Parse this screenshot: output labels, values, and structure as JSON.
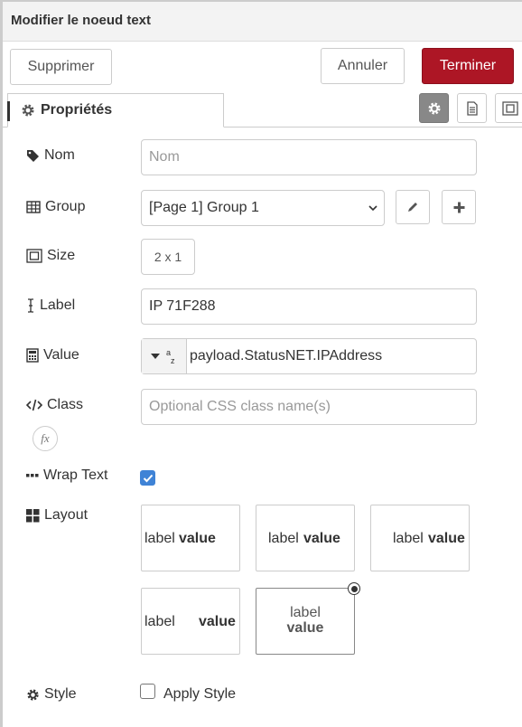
{
  "dialog": {
    "title": "Modifier le noeud text"
  },
  "toolbar": {
    "delete_label": "Supprimer",
    "cancel_label": "Annuler",
    "done_label": "Terminer"
  },
  "tabs": {
    "properties_label": "Propriétés"
  },
  "form": {
    "name": {
      "label": "Nom",
      "placeholder": "Nom",
      "value": ""
    },
    "group": {
      "label": "Group",
      "selected": "[Page 1] Group 1"
    },
    "size": {
      "label": "Size",
      "value": "2 x 1"
    },
    "text_label": {
      "label": "Label",
      "value": "IP 71F288"
    },
    "value": {
      "label": "Value",
      "type_icon": "a-z",
      "value": "payload.StatusNET.IPAddress"
    },
    "class": {
      "label": "Class",
      "placeholder": "Optional CSS class name(s)",
      "fx": "fx"
    },
    "wrap_text": {
      "label": "Wrap Text",
      "checked": true
    },
    "layout": {
      "label": "Layout",
      "options": [
        {
          "label": "label",
          "value": "value"
        },
        {
          "label": "label",
          "value": "value"
        },
        {
          "label": "label",
          "value": "value"
        },
        {
          "label": "label",
          "value": "value"
        },
        {
          "label": "label",
          "value": "value"
        }
      ],
      "selected_index": 4
    },
    "style": {
      "label": "Style",
      "checkbox_label": "Apply Style",
      "checked": false
    }
  },
  "colors": {
    "primary": "#ad1625",
    "checkbox": "#3f83d6"
  },
  "icons": [
    "cog-icon",
    "tag-icon",
    "table-icon",
    "resize-icon",
    "text-cursor-icon",
    "calculator-icon",
    "code-icon",
    "dots-icon",
    "grid-icon",
    "pencil-icon",
    "plus-icon",
    "file-icon",
    "frame-icon"
  ]
}
